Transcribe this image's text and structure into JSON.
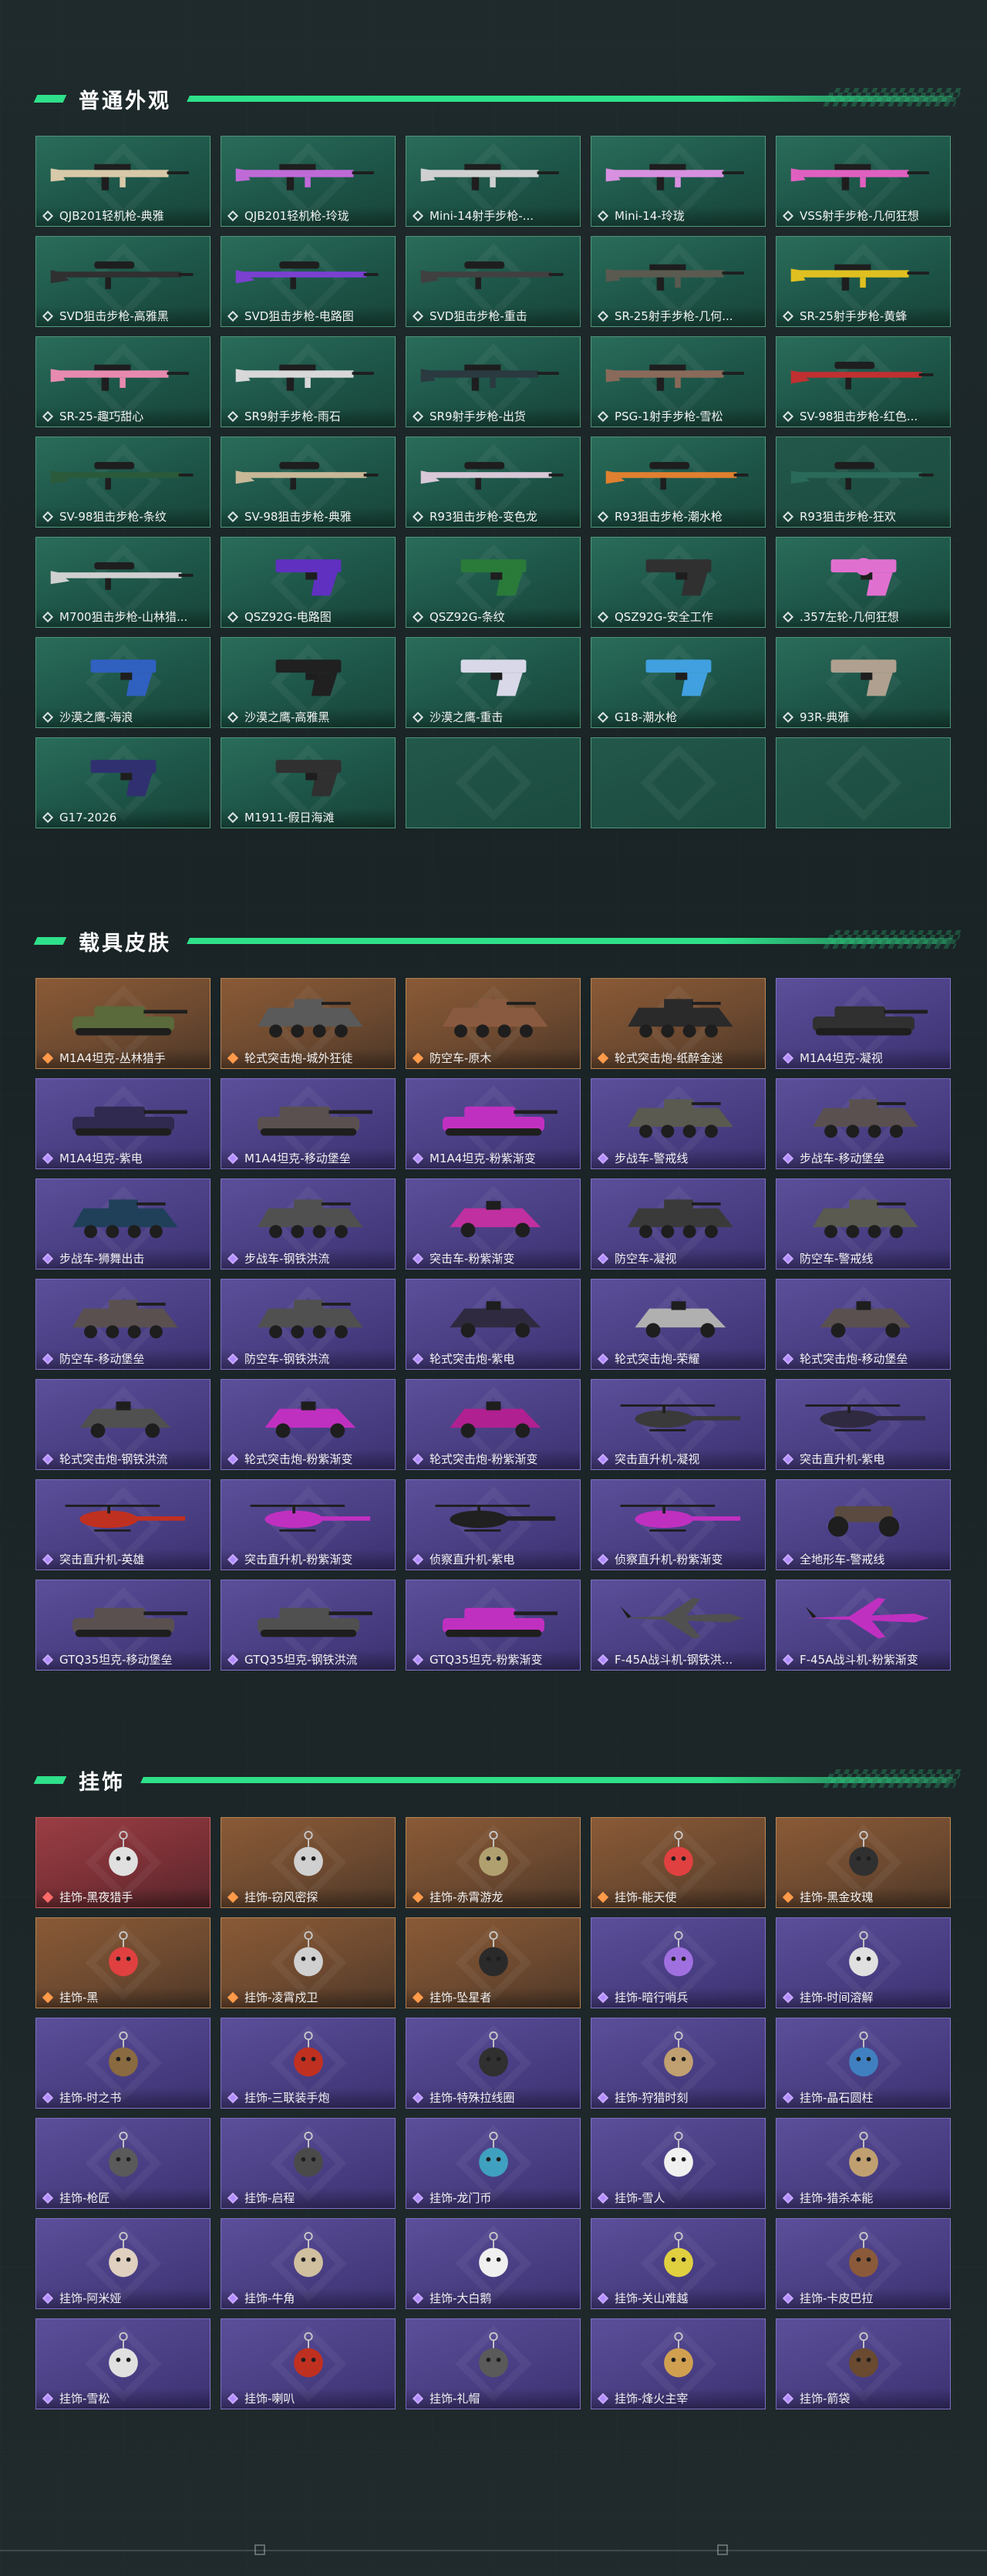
{
  "sections": [
    {
      "title": "普通外观",
      "style": "weapon",
      "items": [
        {
          "label": "QJB201轻机枪-典雅",
          "icon": "rifle-icon",
          "color": "#d8c9a8"
        },
        {
          "label": "QJB201轻机枪-玲珑",
          "icon": "rifle-icon",
          "color": "#c06ad8"
        },
        {
          "label": "Mini-14射手步枪-...",
          "icon": "rifle-icon",
          "color": "#d0d0d0"
        },
        {
          "label": "Mini-14-玲珑",
          "icon": "rifle-icon",
          "color": "#d890e0"
        },
        {
          "label": "VSS射手步枪-几何狂想",
          "icon": "rifle-icon",
          "color": "#e060c0"
        },
        {
          "label": "SVD狙击步枪-高雅黑",
          "icon": "sniper-icon",
          "color": "#303030"
        },
        {
          "label": "SVD狙击步枪-电路图",
          "icon": "sniper-icon",
          "color": "#7a40d0"
        },
        {
          "label": "SVD狙击步枪-重击",
          "icon": "sniper-icon",
          "color": "#404040"
        },
        {
          "label": "SR-25射手步枪-几何...",
          "icon": "rifle-icon",
          "color": "#5a5a50"
        },
        {
          "label": "SR-25射手步枪-黄蜂",
          "icon": "rifle-icon",
          "color": "#e0c020"
        },
        {
          "label": "SR-25-趣巧甜心",
          "icon": "rifle-icon",
          "color": "#e88ab0"
        },
        {
          "label": "SR9射手步枪-雨石",
          "icon": "rifle-icon",
          "color": "#d8d8d8"
        },
        {
          "label": "SR9射手步枪-出货",
          "icon": "rifle-icon",
          "color": "#2a3a40"
        },
        {
          "label": "PSG-1射手步枪-雪松",
          "icon": "rifle-icon",
          "color": "#8a6a5a"
        },
        {
          "label": "SV-98狙击步枪-红色...",
          "icon": "sniper-icon",
          "color": "#c03030"
        },
        {
          "label": "SV-98狙击步枪-条纹",
          "icon": "sniper-icon",
          "color": "#2a5a3a"
        },
        {
          "label": "SV-98狙击步枪-典雅",
          "icon": "sniper-icon",
          "color": "#c8b898"
        },
        {
          "label": "R93狙击步枪-变色龙",
          "icon": "sniper-icon",
          "color": "#d8c8d8"
        },
        {
          "label": "R93狙击步枪-潮水枪",
          "icon": "sniper-icon",
          "color": "#e08030"
        },
        {
          "label": "R93狙击步枪-狂欢",
          "icon": "sniper-icon",
          "color": "#2a6a5a",
          "empty": true
        },
        {
          "label": "M700狙击步枪-山林猎...",
          "icon": "sniper-icon",
          "color": "#d0d0d0"
        },
        {
          "label": "QSZ92G-电路图",
          "icon": "pistol-icon",
          "color": "#6030c0"
        },
        {
          "label": "QSZ92G-条纹",
          "icon": "pistol-icon",
          "color": "#2a7a3a"
        },
        {
          "label": "QSZ92G-安全工作",
          "icon": "pistol-icon",
          "color": "#303030"
        },
        {
          "label": ".357左轮-几何狂想",
          "icon": "revolver-icon",
          "color": "#e070d0"
        },
        {
          "label": "沙漠之鹰-海浪",
          "icon": "pistol-icon",
          "color": "#3060c0"
        },
        {
          "label": "沙漠之鹰-高雅黑",
          "icon": "pistol-icon",
          "color": "#202020"
        },
        {
          "label": "沙漠之鹰-重击",
          "icon": "pistol-icon",
          "color": "#d8d8e8"
        },
        {
          "label": "G18-潮水枪",
          "icon": "pistol-icon",
          "color": "#40a0e0"
        },
        {
          "label": "93R-典雅",
          "icon": "pistol-icon",
          "color": "#b0a090"
        },
        {
          "label": "G17-2026",
          "icon": "pistol-icon",
          "color": "#303070"
        },
        {
          "label": "M1911-假日海滩",
          "icon": "pistol-icon",
          "color": "#303030"
        },
        {
          "label": "",
          "icon": "",
          "color": "",
          "empty": true
        },
        {
          "label": "",
          "icon": "",
          "color": "",
          "empty": true
        },
        {
          "label": "",
          "icon": "",
          "color": "",
          "empty": true
        }
      ]
    },
    {
      "title": "载具皮肤",
      "style": "vehicle",
      "items": [
        {
          "label": "M1A4坦克-丛林猎手",
          "icon": "tank-icon",
          "tier": "orange",
          "color": "#5a6a3a"
        },
        {
          "label": "轮式突击炮-城外狂徒",
          "icon": "apc-icon",
          "tier": "orange",
          "color": "#5a5a5a"
        },
        {
          "label": "防空车-原木",
          "icon": "apc-icon",
          "tier": "orange",
          "color": "#8a5a40"
        },
        {
          "label": "轮式突击炮-纸醉金迷",
          "icon": "apc-icon",
          "tier": "orange",
          "color": "#2a2a2a"
        },
        {
          "label": "M1A4坦克-凝视",
          "icon": "tank-icon",
          "tier": "purple",
          "color": "#303030"
        },
        {
          "label": "M1A4坦克-紫电",
          "icon": "tank-icon",
          "tier": "purple",
          "color": "#302a50"
        },
        {
          "label": "M1A4坦克-移动堡垒",
          "icon": "tank-icon",
          "tier": "purple",
          "color": "#5a5050"
        },
        {
          "label": "M1A4坦克-粉紫渐变",
          "icon": "tank-icon",
          "tier": "purple",
          "color": "#c030c0"
        },
        {
          "label": "步战车-警戒线",
          "icon": "apc-icon",
          "tier": "purple",
          "color": "#5a5a50"
        },
        {
          "label": "步战车-移动堡垒",
          "icon": "apc-icon",
          "tier": "purple",
          "color": "#5a5050"
        },
        {
          "label": "步战车-狮舞出击",
          "icon": "apc-icon",
          "tier": "purple",
          "color": "#20405a"
        },
        {
          "label": "步战车-钢铁洪流",
          "icon": "apc-icon",
          "tier": "purple",
          "color": "#505050"
        },
        {
          "label": "突击车-粉紫渐变",
          "icon": "car-icon",
          "tier": "purple",
          "color": "#c030a0"
        },
        {
          "label": "防空车-凝视",
          "icon": "apc-icon",
          "tier": "purple",
          "color": "#3a3a3a"
        },
        {
          "label": "防空车-警戒线",
          "icon": "apc-icon",
          "tier": "purple",
          "color": "#5a5a50"
        },
        {
          "label": "防空车-移动堡垒",
          "icon": "apc-icon",
          "tier": "purple",
          "color": "#5a5050"
        },
        {
          "label": "防空车-钢铁洪流",
          "icon": "apc-icon",
          "tier": "purple",
          "color": "#505050"
        },
        {
          "label": "轮式突击炮-紫电",
          "icon": "car-icon",
          "tier": "purple",
          "color": "#302a40"
        },
        {
          "label": "轮式突击炮-荣耀",
          "icon": "car-icon",
          "tier": "purple",
          "color": "#b0b0b0"
        },
        {
          "label": "轮式突击炮-移动堡垒",
          "icon": "car-icon",
          "tier": "purple",
          "color": "#5a5050"
        },
        {
          "label": "轮式突击炮-钢铁洪流",
          "icon": "car-icon",
          "tier": "purple",
          "color": "#505050"
        },
        {
          "label": "轮式突击炮-粉紫渐变",
          "icon": "car-icon",
          "tier": "purple",
          "color": "#c030c0"
        },
        {
          "label": "轮式突击炮-粉紫渐变",
          "icon": "car-icon",
          "tier": "purple",
          "color": "#b02090"
        },
        {
          "label": "突击直升机-凝视",
          "icon": "helicopter-icon",
          "tier": "purple",
          "color": "#3a3a3a"
        },
        {
          "label": "突击直升机-紫电",
          "icon": "helicopter-icon",
          "tier": "purple",
          "color": "#302a40"
        },
        {
          "label": "突击直升机-英雄",
          "icon": "helicopter-icon",
          "tier": "purple",
          "color": "#c03020"
        },
        {
          "label": "突击直升机-粉紫渐变",
          "icon": "helicopter-icon",
          "tier": "purple",
          "color": "#c030c0"
        },
        {
          "label": "侦察直升机-紫电",
          "icon": "helicopter-icon",
          "tier": "purple",
          "color": "#202020"
        },
        {
          "label": "侦察直升机-粉紫渐变",
          "icon": "helicopter-icon",
          "tier": "purple",
          "color": "#c030c0"
        },
        {
          "label": "全地形车-警戒线",
          "icon": "atv-icon",
          "tier": "purple",
          "color": "#5a4a40"
        },
        {
          "label": "GTQ35坦克-移动堡垒",
          "icon": "tank-icon",
          "tier": "purple",
          "color": "#5a5050"
        },
        {
          "label": "GTQ35坦克-钢铁洪流",
          "icon": "tank-icon",
          "tier": "purple",
          "color": "#505050"
        },
        {
          "label": "GTQ35坦克-粉紫渐变",
          "icon": "tank-icon",
          "tier": "purple",
          "color": "#c030c0"
        },
        {
          "label": "F-45A战斗机-钢铁洪...",
          "icon": "jet-icon",
          "tier": "purple",
          "color": "#505050"
        },
        {
          "label": "F-45A战斗机-粉紫渐变",
          "icon": "jet-icon",
          "tier": "purple",
          "color": "#c030c0"
        }
      ]
    },
    {
      "title": "挂饰",
      "style": "charm",
      "items": [
        {
          "label": "挂饰-黑夜猎手",
          "icon": "charm-icon",
          "tier": "red",
          "color": "#e0e0e0"
        },
        {
          "label": "挂饰-窃风密探",
          "icon": "charm-icon",
          "tier": "orange",
          "color": "#d0d0d0"
        },
        {
          "label": "挂饰-赤霄游龙",
          "icon": "charm-icon",
          "tier": "orange",
          "color": "#b0a070"
        },
        {
          "label": "挂饰-能天使",
          "icon": "charm-icon",
          "tier": "orange",
          "color": "#e04040"
        },
        {
          "label": "挂饰-黑金玫瑰",
          "icon": "charm-icon",
          "tier": "orange",
          "color": "#303030"
        },
        {
          "label": "挂饰-黑",
          "icon": "charm-icon",
          "tier": "orange",
          "color": "#e04040"
        },
        {
          "label": "挂饰-凌霄戍卫",
          "icon": "charm-icon",
          "tier": "orange",
          "color": "#d0d0d0"
        },
        {
          "label": "挂饰-坠星者",
          "icon": "charm-icon",
          "tier": "orange",
          "color": "#2a2a2a"
        },
        {
          "label": "挂饰-暗行哨兵",
          "icon": "charm-icon",
          "tier": "purple",
          "color": "#a070e0"
        },
        {
          "label": "挂饰-时间溶解",
          "icon": "charm-icon",
          "tier": "purple",
          "color": "#e0e0e0"
        },
        {
          "label": "挂饰-时之书",
          "icon": "charm-icon",
          "tier": "purple",
          "color": "#8a6a40"
        },
        {
          "label": "挂饰-三联装手炮",
          "icon": "charm-icon",
          "tier": "purple",
          "color": "#c03020"
        },
        {
          "label": "挂饰-特殊拉线圈",
          "icon": "charm-icon",
          "tier": "purple",
          "color": "#303030"
        },
        {
          "label": "挂饰-狩猎时刻",
          "icon": "charm-icon",
          "tier": "purple",
          "color": "#c0a070"
        },
        {
          "label": "挂饰-晶石圆柱",
          "icon": "charm-icon",
          "tier": "purple",
          "color": "#4080c0"
        },
        {
          "label": "挂饰-枪匠",
          "icon": "charm-icon",
          "tier": "purple",
          "color": "#5a5a5a"
        },
        {
          "label": "挂饰-启程",
          "icon": "charm-icon",
          "tier": "purple",
          "color": "#4a4a4a"
        },
        {
          "label": "挂饰-龙门币",
          "icon": "charm-icon",
          "tier": "purple",
          "color": "#40a0c0"
        },
        {
          "label": "挂饰-雪人",
          "icon": "charm-icon",
          "tier": "purple",
          "color": "#f0f0f0"
        },
        {
          "label": "挂饰-猎杀本能",
          "icon": "charm-icon",
          "tier": "purple",
          "color": "#c0a070"
        },
        {
          "label": "挂饰-阿米娅",
          "icon": "charm-icon",
          "tier": "purple",
          "color": "#e0d0c0"
        },
        {
          "label": "挂饰-牛角",
          "icon": "charm-icon",
          "tier": "purple",
          "color": "#d0c0a0"
        },
        {
          "label": "挂饰-大白鹅",
          "icon": "charm-icon",
          "tier": "purple",
          "color": "#f0f0f0"
        },
        {
          "label": "挂饰-关山难越",
          "icon": "charm-icon",
          "tier": "purple",
          "color": "#e0d040"
        },
        {
          "label": "挂饰-卡皮巴拉",
          "icon": "charm-icon",
          "tier": "purple",
          "color": "#8a5a3a"
        },
        {
          "label": "挂饰-雪松",
          "icon": "charm-icon",
          "tier": "purple",
          "color": "#e0e0e0"
        },
        {
          "label": "挂饰-喇叭",
          "icon": "charm-icon",
          "tier": "purple",
          "color": "#c03020"
        },
        {
          "label": "挂饰-礼帽",
          "icon": "charm-icon",
          "tier": "purple",
          "color": "#5a5a5a"
        },
        {
          "label": "挂饰-烽火主宰",
          "icon": "charm-icon",
          "tier": "purple",
          "color": "#d0a050"
        },
        {
          "label": "挂饰-箭袋",
          "icon": "charm-icon",
          "tier": "purple",
          "color": "#6a4a30"
        }
      ]
    }
  ]
}
